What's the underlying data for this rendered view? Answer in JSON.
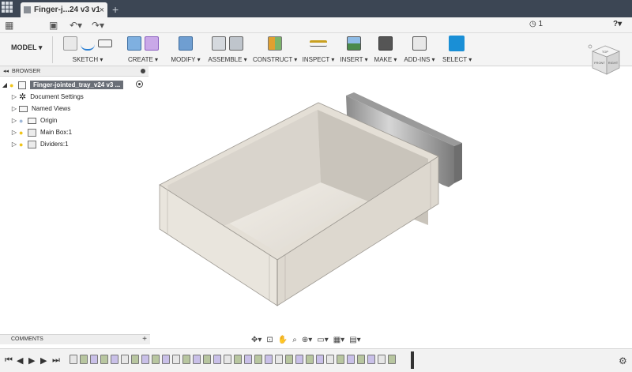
{
  "tab": {
    "title": "Finger-j...24 v3 v1",
    "close": "×",
    "new": "+"
  },
  "quickbar": {
    "job_status": "1",
    "help": "?"
  },
  "toolbar": {
    "model": "MODEL ▾",
    "groups": {
      "sketch": "SKETCH ▾",
      "create": "CREATE ▾",
      "modify": "MODIFY ▾",
      "assemble": "ASSEMBLE ▾",
      "construct": "CONSTRUCT ▾",
      "inspect": "INSPECT ▾",
      "insert": "INSERT ▾",
      "make": "MAKE ▾",
      "addins": "ADD-INS ▾",
      "select": "SELECT ▾"
    }
  },
  "viewcube": {
    "top": "TOP",
    "front": "FRONT",
    "right": "RIGHT"
  },
  "browser": {
    "header": "BROWSER",
    "root": "Finger-jointed_tray_v24 v3 ...",
    "items": {
      "document_settings": "Document Settings",
      "named_views": "Named Views",
      "origin": "Origin",
      "main_box": "Main Box:1",
      "dividers": "Dividers:1"
    }
  },
  "comments": {
    "label": "COMMENTS",
    "add": "+"
  },
  "colors": {
    "accent": "#1a8fd6",
    "tab_bar": "#3c4654",
    "model_face": "#e6e1d8"
  }
}
